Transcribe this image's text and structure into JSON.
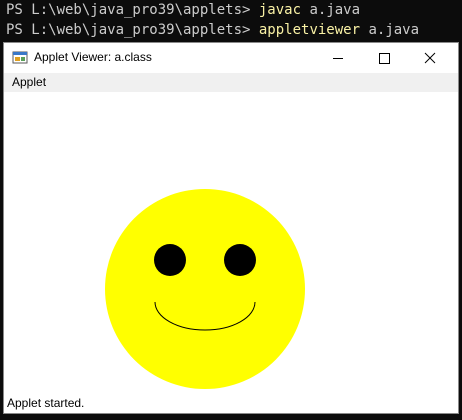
{
  "terminal": {
    "lines": [
      {
        "prompt": "PS L:\\web\\java_pro39\\applets> ",
        "command": "javac",
        "args": " a.java"
      },
      {
        "prompt": "PS L:\\web\\java_pro39\\applets> ",
        "command": "appletviewer",
        "args": " a.java"
      }
    ]
  },
  "window": {
    "title": "Applet Viewer: a.class",
    "menu": {
      "applet": "Applet"
    },
    "status": "Applet started."
  },
  "icons": {
    "app": "java-applet-icon",
    "minimize": "minimize-icon",
    "maximize": "maximize-icon",
    "close": "close-icon"
  },
  "colors": {
    "face": "#ffff00",
    "features": "#000000",
    "terminal_bg": "#0c0c0c",
    "terminal_text": "#cccccc",
    "terminal_command": "#f9f1a5"
  }
}
